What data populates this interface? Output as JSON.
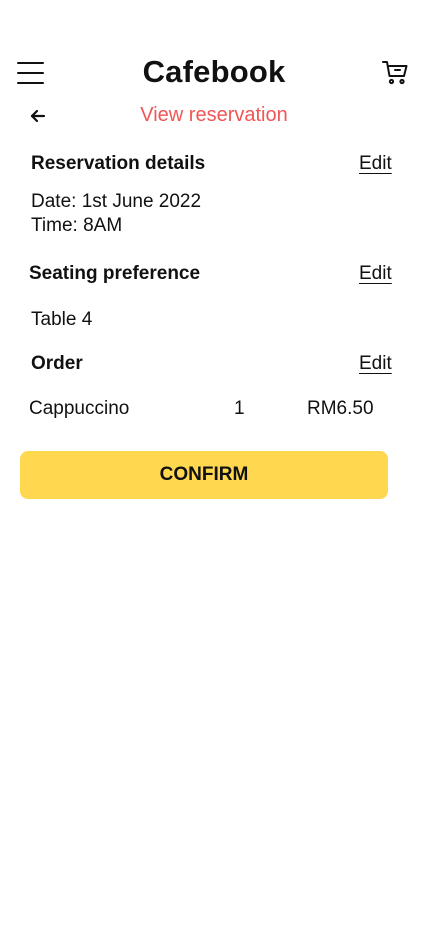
{
  "header": {
    "title": "Cafebook"
  },
  "subheader": {
    "title": "View reservation"
  },
  "reservation_details": {
    "title": "Reservation details",
    "edit_label": "Edit",
    "date": "Date: 1st June 2022",
    "time": "Time: 8AM"
  },
  "seating": {
    "title": "Seating preference",
    "edit_label": "Edit",
    "value": "Table 4"
  },
  "order": {
    "title": "Order",
    "edit_label": "Edit",
    "items": [
      {
        "name": "Cappuccino",
        "quantity": "1",
        "price": "RM6.50"
      }
    ]
  },
  "confirm_label": "CONFIRM",
  "colors": {
    "accent": "#f25555",
    "button": "#ffd84f",
    "text": "#111111"
  },
  "icons": {
    "menu": "hamburger-menu-icon",
    "cart": "cart-icon",
    "back": "arrow-left-icon"
  }
}
